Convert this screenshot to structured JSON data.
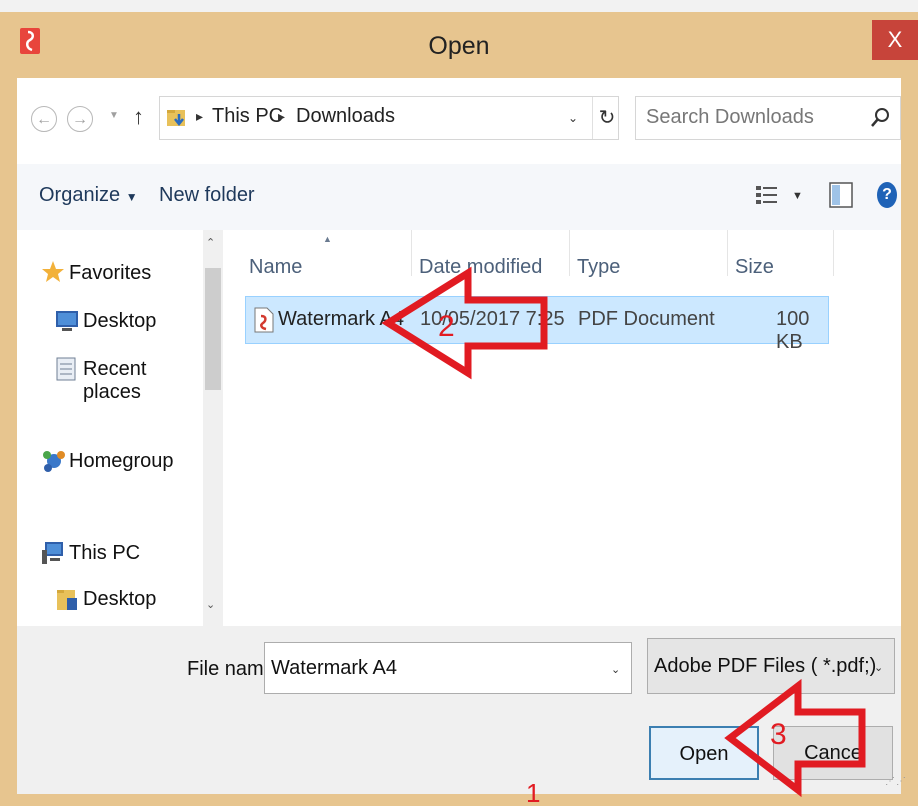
{
  "window": {
    "title": "Open",
    "close_label": "X"
  },
  "address": {
    "path": [
      "This PC",
      "Downloads"
    ],
    "search_placeholder": "Search Downloads"
  },
  "toolbar": {
    "organize": "Organize",
    "new_folder": "New folder"
  },
  "nav": {
    "favorites": "Favorites",
    "favorites_items": [
      "Desktop",
      "Recent places"
    ],
    "homegroup": "Homegroup",
    "thispc": "This PC",
    "thispc_items": [
      "Desktop"
    ]
  },
  "columns": {
    "name": "Name",
    "date": "Date modified",
    "type": "Type",
    "size": "Size"
  },
  "files": [
    {
      "name": "Watermark A4",
      "date": "10/05/2017 7:25",
      "type": "PDF Document",
      "size": "100 KB"
    }
  ],
  "bottom": {
    "filename_label": "File name:",
    "filename_value": "Watermark A4",
    "filter": "Adobe PDF Files ( *.pdf;)",
    "open": "Open",
    "cancel": "Cance"
  },
  "annotations": [
    "1",
    "2",
    "3"
  ],
  "colors": {
    "annotation": "#e11b22",
    "title_bar": "#e7c58f",
    "selection": "#cce8ff",
    "close": "#c7443a"
  }
}
